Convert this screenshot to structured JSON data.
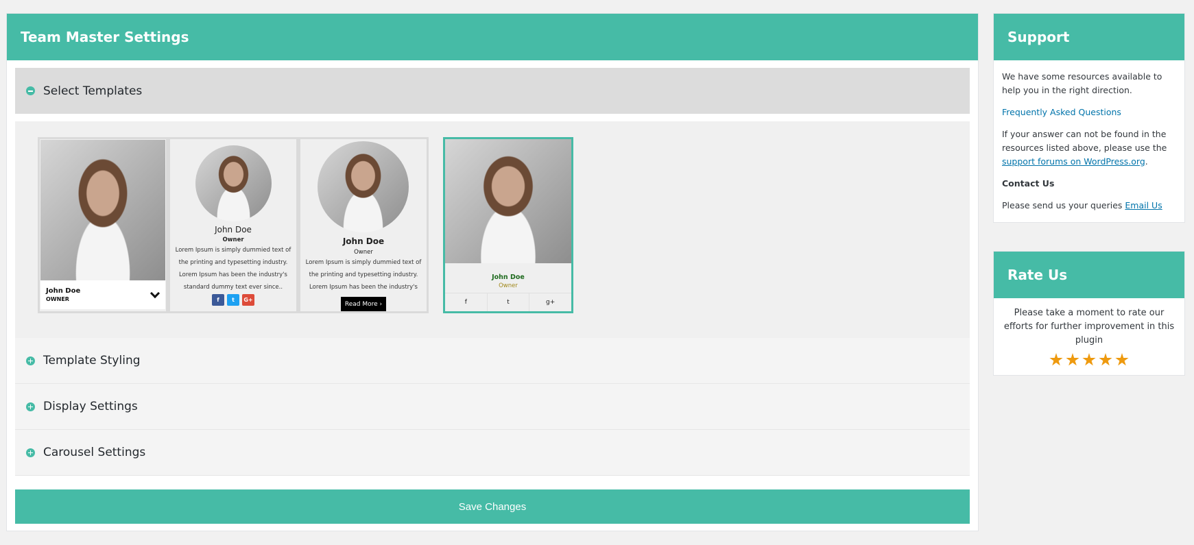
{
  "main": {
    "title": "Team Master Settings",
    "sections": [
      {
        "label": "Select Templates",
        "open": true
      },
      {
        "label": "Template Styling",
        "open": false
      },
      {
        "label": "Display Settings",
        "open": false
      },
      {
        "label": "Carousel Settings",
        "open": false
      }
    ],
    "templates": [
      {
        "name": "John Doe",
        "role": "OWNER",
        "selected": false
      },
      {
        "name": "John Doe",
        "role": "Owner",
        "text": "Lorem Ipsum is simply dummied text of the printing and typesetting industry. Lorem Ipsum has been the industry's standard dummy text ever since..",
        "social": [
          "facebook",
          "twitter",
          "google-plus"
        ],
        "selected": false
      },
      {
        "name": "John Doe",
        "role": "Owner",
        "text": "Lorem Ipsum is simply dummied text of the printing and typesetting industry. Lorem Ipsum has been the industry's",
        "button": "Read More ›",
        "selected": false
      },
      {
        "name": "John Doe",
        "role": "Owner",
        "social": [
          "facebook",
          "twitter",
          "google-plus"
        ],
        "selected": true
      }
    ],
    "save_label": "Save Changes"
  },
  "support": {
    "title": "Support",
    "intro": "We have some resources available to help you in the right direction.",
    "faq_link": "Frequently Asked Questions",
    "not_found_text": "If your answer can not be found in the resources listed above, please use the",
    "forum_link": "support forums on WordPress.org",
    "contact_heading": "Contact Us",
    "queries_text": "Please send us your queries",
    "email_link": "Email Us"
  },
  "rate": {
    "title": "Rate Us",
    "text": "Please take a moment to rate our efforts for further improvement in this plugin",
    "stars": 5
  },
  "colors": {
    "accent": "#46bba6",
    "link": "#0073aa",
    "star": "#ee9a0f"
  }
}
